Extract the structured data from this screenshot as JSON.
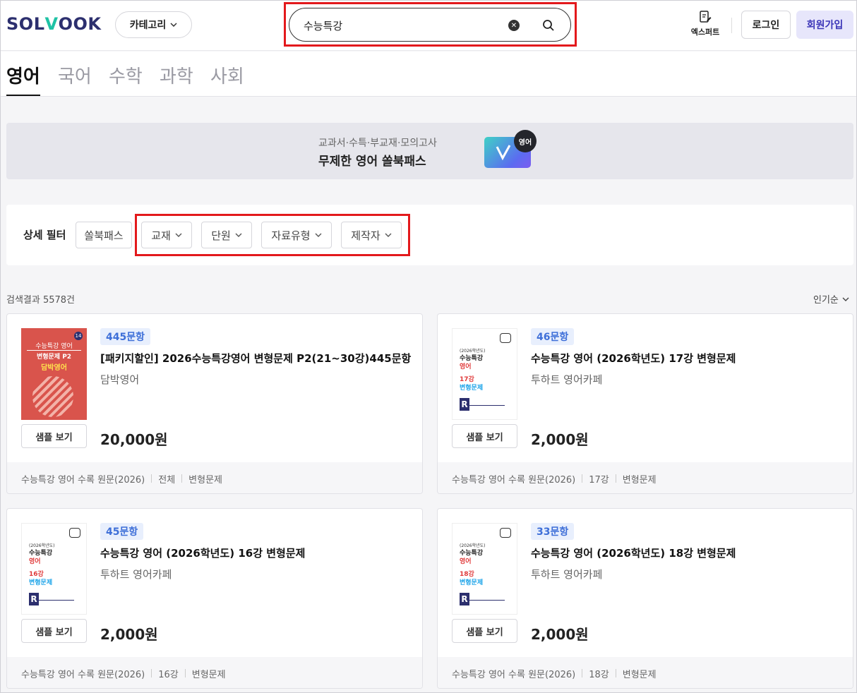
{
  "header": {
    "logo_left": "SOL",
    "logo_v": "V",
    "logo_right": "OOK",
    "category_label": "카테고리",
    "search_value": "수능특강",
    "expert_label": "엑스퍼트",
    "login_label": "로그인",
    "signup_label": "회원가입"
  },
  "tabs": [
    {
      "label": "영어",
      "active": true
    },
    {
      "label": "국어",
      "active": false
    },
    {
      "label": "수학",
      "active": false
    },
    {
      "label": "과학",
      "active": false
    },
    {
      "label": "사회",
      "active": false
    }
  ],
  "banner": {
    "subtitle": "교과서·수특·부교재·모의고사",
    "title": "무제한 영어 쏠북패스",
    "badge": "영어"
  },
  "filter": {
    "label": "상세 필터",
    "chips": [
      "쏠북패스",
      "교재",
      "단원",
      "자료유형",
      "제작자"
    ]
  },
  "results": {
    "count_text": "검색결과 5578건",
    "sort_label": "인기순"
  },
  "products": [
    {
      "badge": "445문항",
      "title": "[패키지할인] 2026수능특강영어 변형문제 P2(21~30강)445문항",
      "author": "담박영어",
      "price": "20,000원",
      "sample_label": "샘플 보기",
      "tags": [
        "수능특강 영어 수록 원문(2026)",
        "전체",
        "변형문제"
      ],
      "cover": {
        "type": "red",
        "line1": "수능특강 영어",
        "line2": "변형문제 P2",
        "line3": "담박영어",
        "mini": "14"
      }
    },
    {
      "badge": "46문항",
      "title": "수능특강 영어 (2026학년도) 17강 변형문제",
      "author": "투하트 영어카페",
      "price": "2,000원",
      "sample_label": "샘플 보기",
      "tags": [
        "수능특강 영어 수록 원문(2026)",
        "17강",
        "변형문제"
      ],
      "cover": {
        "type": "white",
        "yr": "(2026학년도)",
        "a": "수능특강",
        "b": "영어",
        "c": "17강",
        "d": "변형문제"
      }
    },
    {
      "badge": "45문항",
      "title": "수능특강 영어 (2026학년도) 16강 변형문제",
      "author": "투하트 영어카페",
      "price": "2,000원",
      "sample_label": "샘플 보기",
      "tags": [
        "수능특강 영어 수록 원문(2026)",
        "16강",
        "변형문제"
      ],
      "cover": {
        "type": "white",
        "yr": "(2026학년도)",
        "a": "수능특강",
        "b": "영어",
        "c": "16강",
        "d": "변형문제"
      }
    },
    {
      "badge": "33문항",
      "title": "수능특강 영어 (2026학년도) 18강 변형문제",
      "author": "투하트 영어카페",
      "price": "2,000원",
      "sample_label": "샘플 보기",
      "tags": [
        "수능특강 영어 수록 원문(2026)",
        "18강",
        "변형문제"
      ],
      "cover": {
        "type": "white",
        "yr": "(2026학년도)",
        "a": "수능특강",
        "b": "영어",
        "c": "18강",
        "d": "변형문제"
      }
    }
  ],
  "colors": {
    "brand_navy": "#2c2f6e",
    "brand_teal": "#1fc2a5",
    "badge_blue": "#3e6fd8",
    "highlight_red": "#e3191c",
    "signup_bg": "#e7e6fb"
  }
}
